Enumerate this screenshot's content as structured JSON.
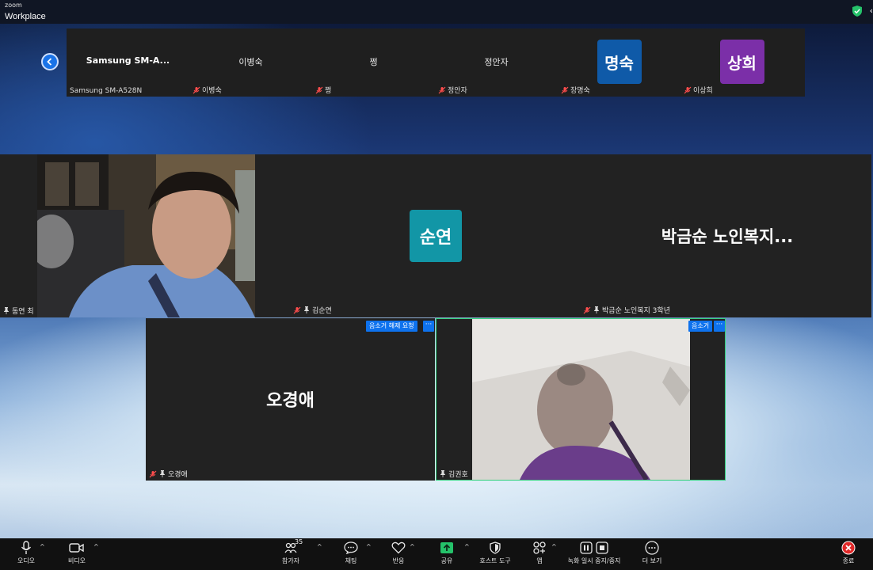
{
  "app": {
    "brand_small": "zoom",
    "brand_main": "Workplace"
  },
  "strip": {
    "tiles": [
      {
        "center_name": "Samsung  SM-A...",
        "label": "Samsung SM-A528N"
      },
      {
        "center_name": "이병숙",
        "label": "이병숙"
      },
      {
        "center_name": "쩡",
        "label": "쩡"
      },
      {
        "center_name": "정안자",
        "label": "정안자"
      },
      {
        "avatar_text": "명숙",
        "avatar_color": "#0f5aa8",
        "label": "장명숙"
      },
      {
        "avatar_text": "상희",
        "avatar_color": "#7b2fa8",
        "label": "이상희"
      }
    ]
  },
  "mid_row": {
    "video_label": "동연 최",
    "center_tile": {
      "avatar_text": "순연",
      "avatar_color": "#1296a6",
      "label": "김순연"
    },
    "right_tile": {
      "name": "박금순 노인복지...",
      "label": "박금순 노인복지 3학년"
    }
  },
  "bottom_row": {
    "left_tile": {
      "name": "오경애",
      "label": "오경애",
      "tag": "음소거 해제 요청",
      "more": "···"
    },
    "right_tile": {
      "label": "김권호",
      "tag": "음소거",
      "more": "···",
      "border_color": "#2fd07a"
    }
  },
  "toolbar": {
    "audio": "오디오",
    "video": "비디오",
    "participants": "참가자",
    "participants_count": "35",
    "chat": "채팅",
    "reactions": "반응",
    "share": "공유",
    "host_tools": "호스트 도구",
    "apps": "앱",
    "recording": "녹화 일시 중지/중지",
    "more": "더 보기",
    "end": "종료"
  },
  "colors": {
    "share_green": "#25c26a",
    "end_red": "#e02828",
    "accent_blue": "#0e72ed"
  }
}
